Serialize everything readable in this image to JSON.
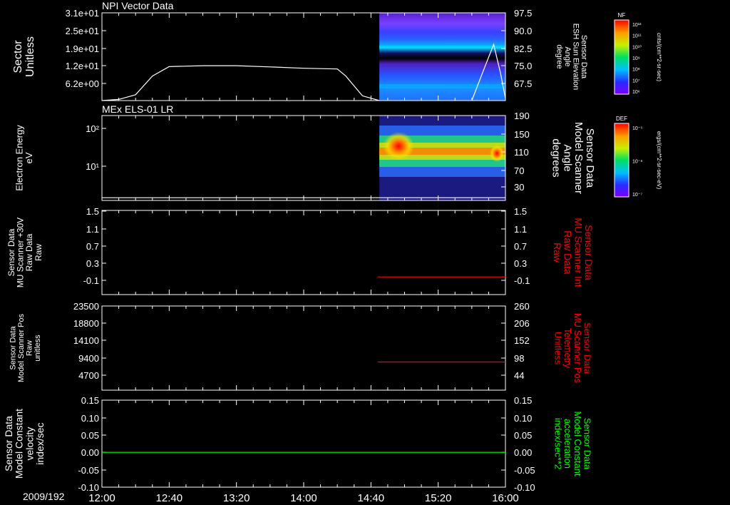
{
  "date_label": "2009/192",
  "time_ticks": [
    "12:00",
    "12:40",
    "13:20",
    "14:00",
    "14:40",
    "15:20",
    "16:00"
  ],
  "cbar_nf": {
    "tag": "NF",
    "units": "cnts/(cm**2-sr-sec)",
    "ticks": [
      "10¹²",
      "10¹¹",
      "10¹⁰",
      "10⁹",
      "10⁸",
      "10⁷",
      "10⁶"
    ]
  },
  "cbar_def": {
    "tag": "DEF",
    "units": "ergs/(cm**2-sr-sec-eV)",
    "ticks": [
      "10⁻⁵",
      "10⁻⁶",
      "10⁻⁷"
    ]
  },
  "colors": {
    "white": "#ffffff",
    "red": "#ff0000",
    "green": "#00ff00",
    "background": "#000000"
  },
  "chart_data": [
    {
      "type": "line",
      "title": "NPI Vector Data",
      "ylabel_left": [
        "Sector",
        "Unitless"
      ],
      "yticks_left": [
        "3.1e+01",
        "2.5e+01",
        "1.9e+01",
        "1.2e+01",
        "6.2e+00"
      ],
      "ylabel_right": [
        "Sensor Data",
        "ESH Sun Elevation",
        "Angle",
        "degree"
      ],
      "yticks_right": [
        "97.5",
        "90.0",
        "82.5",
        "75.0",
        "67.5"
      ],
      "ylim_right": [
        60,
        97.5
      ],
      "spectrogram": {
        "x_start": "14:45",
        "x_end": "16:00",
        "colorbar": "NF"
      },
      "series": [
        {
          "color": "#ffffff",
          "x": [
            "12:00",
            "12:10",
            "12:20",
            "12:30",
            "12:40",
            "13:00",
            "13:20",
            "13:40",
            "14:00",
            "14:20",
            "14:25",
            "14:35",
            "14:45"
          ],
          "y": [
            60.0,
            60.5,
            62.5,
            70.5,
            74.5,
            74.9,
            74.9,
            74.4,
            73.8,
            73.5,
            70.5,
            62.0,
            60.0
          ]
        },
        {
          "color": "#ffffff",
          "x": [
            "15:40",
            "15:47",
            "15:53",
            "15:57",
            "16:00"
          ],
          "y": [
            60.0,
            73.0,
            84.0,
            72.0,
            61.0
          ]
        }
      ]
    },
    {
      "type": "heatmap",
      "title": "MEx ELS-01 LR",
      "ylabel_left": [
        "Electron Energy",
        "eV"
      ],
      "yticks_left": [
        "10²",
        "10¹"
      ],
      "ylabel_right": [
        "Sensor Data",
        "Model Scanner",
        "Angle",
        "degrees"
      ],
      "yticks_right": [
        "190",
        "150",
        "110",
        "70",
        "30"
      ],
      "ylim_right": [
        0,
        190
      ],
      "spectrogram": {
        "x_start": "14:45",
        "x_end": "16:00",
        "colorbar": "DEF"
      },
      "series": [
        {
          "color": "#ffffff",
          "x": [
            "12:00",
            "16:00"
          ],
          "y": [
            6,
            6
          ]
        }
      ]
    },
    {
      "type": "line",
      "ylabel_left": [
        "Sensor Data",
        "MU Scanner +30V",
        "Raw Data",
        "Raw"
      ],
      "yticks_left": [
        "1.5",
        "1.1",
        "0.7",
        "0.3",
        "-0.1"
      ],
      "ylabel_right": [
        "Sensor Data",
        "MU Scanner Int",
        "Raw Data",
        "Raw"
      ],
      "yticks_right": [
        "1.5",
        "1.1",
        "0.7",
        "0.3",
        "-0.1"
      ],
      "ylim": [
        -0.4,
        1.5
      ],
      "series": [
        {
          "color": "#ff0000",
          "x": [
            "14:44",
            "16:00"
          ],
          "y": [
            0.0,
            0.0
          ]
        }
      ]
    },
    {
      "type": "line",
      "ylabel_left": [
        "Sensor Data",
        "Model Scanner Pos",
        "Raw",
        "unitless"
      ],
      "yticks_left": [
        "23500",
        "18800",
        "14100",
        "9400",
        "4700"
      ],
      "ylabel_right": [
        "Sensor Data",
        "MU Scanner Pos",
        "Telemetry",
        "Unitless"
      ],
      "yticks_right": [
        "260",
        "206",
        "152",
        "98",
        "44"
      ],
      "ylim_right": [
        0,
        260
      ],
      "series": [
        {
          "color": "#ff0000",
          "x": [
            "14:44",
            "16:00"
          ],
          "y": [
            87,
            87
          ]
        }
      ]
    },
    {
      "type": "line",
      "ylabel_left": [
        "Sensor Data",
        "Model Constant",
        "velocity",
        "index/sec"
      ],
      "yticks_left": [
        "0.15",
        "0.10",
        "0.05",
        "0.00",
        "-0.05",
        "-0.10"
      ],
      "ylabel_right": [
        "Sensor Data",
        "Model Constant",
        "acceleration",
        "index/sec**2"
      ],
      "yticks_right": [
        "0.15",
        "0.10",
        "0.05",
        "0.00",
        "-0.05",
        "-0.10"
      ],
      "ylim": [
        -0.1,
        0.15
      ],
      "series": [
        {
          "color": "#00ff00",
          "x": [
            "12:00",
            "16:00"
          ],
          "y": [
            0.0,
            0.0
          ]
        }
      ]
    }
  ]
}
